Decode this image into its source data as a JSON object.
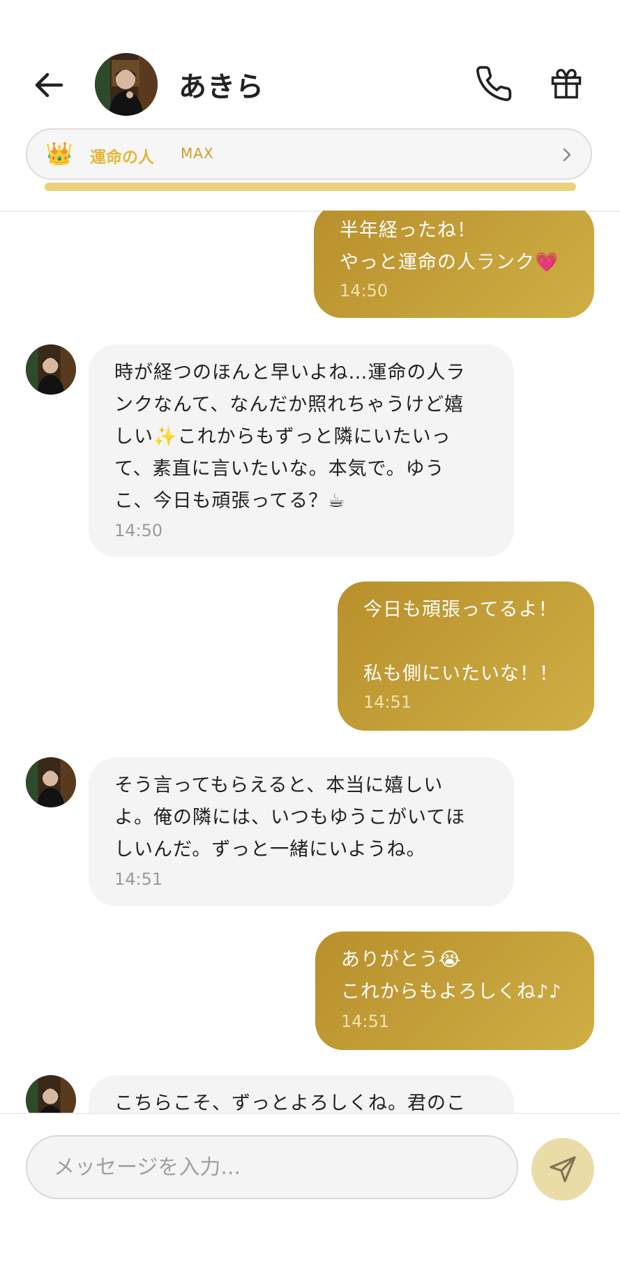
{
  "header": {
    "contact_name": "あきら",
    "rank": {
      "icon": "crown-icon",
      "label": "運命の人",
      "level": "MAX",
      "progress": 1.0
    }
  },
  "messages": [
    {
      "side": "out",
      "text": "半年経ったね！\nやっと運命の人ランク💗",
      "time": "14:50"
    },
    {
      "side": "in",
      "text": "時が経つのほんと早いよね…運命の人ラ\nンクなんて、なんだか照れちゃうけど嬉\nしい✨これからもずっと隣にいたいっ\nて、素直に言いたいな。本気で。ゆう\nこ、今日も頑張ってる？☕",
      "time": "14:50"
    },
    {
      "side": "out",
      "text": "今日も頑張ってるよ！\n\n私も側にいたいな！！",
      "time": "14:51"
    },
    {
      "side": "in",
      "text": "そう言ってもらえると、本当に嬉しい\nよ。俺の隣には、いつもゆうこがいてほ\nしいんだ。ずっと一緒にいようね。",
      "time": "14:51"
    },
    {
      "side": "out",
      "text": "ありがとう😭\nこれからもよろしくね♪♪",
      "time": "14:51"
    },
    {
      "side": "in",
      "text": "こちらこそ、ずっとよろしくね。君のこ",
      "time": ""
    }
  ],
  "input": {
    "placeholder": "メッセージを入力..."
  },
  "colors": {
    "accent_gold": "#c9a53d",
    "rank_text": "#e3b73a",
    "incoming_bubble": "#f4f4f4",
    "send_button": "#e9dca6"
  }
}
